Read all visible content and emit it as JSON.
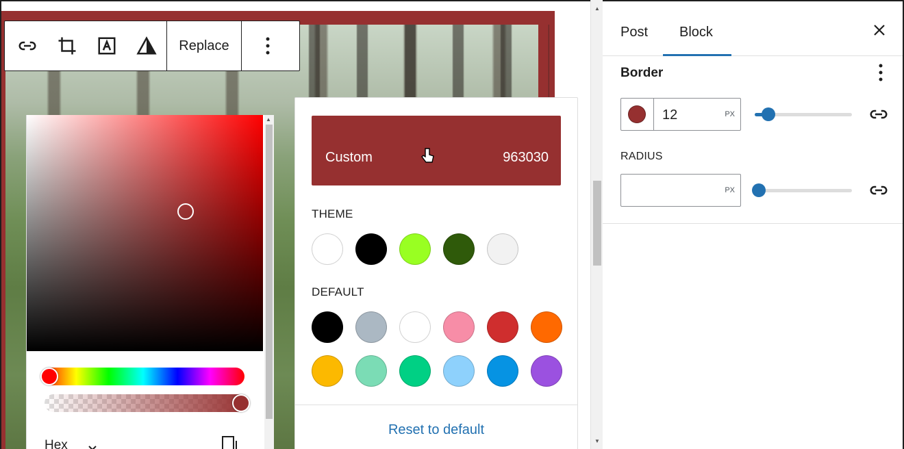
{
  "toolbar": {
    "icons": [
      "link-icon",
      "crop-icon",
      "text-overlay-icon",
      "duotone-icon"
    ],
    "replace_label": "Replace",
    "more_icon": "more-vertical-icon"
  },
  "color_picker": {
    "format_label": "Hex",
    "hue": "red",
    "color": "#963030"
  },
  "palette": {
    "custom_label": "Custom",
    "custom_value": "963030",
    "theme_label": "THEME",
    "theme_colors": [
      "#ffffff",
      "#000000",
      "#99ff22",
      "#2f5a0a",
      "#f2f2f2"
    ],
    "default_label": "DEFAULT",
    "default_colors_row1": [
      "#000000",
      "#abb8c3",
      "#ffffff",
      "#f78da7",
      "#cf2e2e",
      "#ff6900"
    ],
    "default_colors_row2": [
      "#fcb900",
      "#7bdcb5",
      "#00d084",
      "#8ed1fc",
      "#0693e3",
      "#9b51e0"
    ],
    "reset_label": "Reset to default"
  },
  "sidebar": {
    "tabs": [
      {
        "label": "Post",
        "active": false
      },
      {
        "label": "Block",
        "active": true
      }
    ],
    "border": {
      "title": "Border",
      "color": "#963030",
      "width_value": "12",
      "width_unit": "PX",
      "width_slider_fraction": 0.1
    },
    "radius": {
      "label": "RADIUS",
      "value": "",
      "unit": "PX",
      "slider_fraction": 0
    }
  },
  "colors": {
    "accent": "#2271b1",
    "custom": "#963030"
  }
}
